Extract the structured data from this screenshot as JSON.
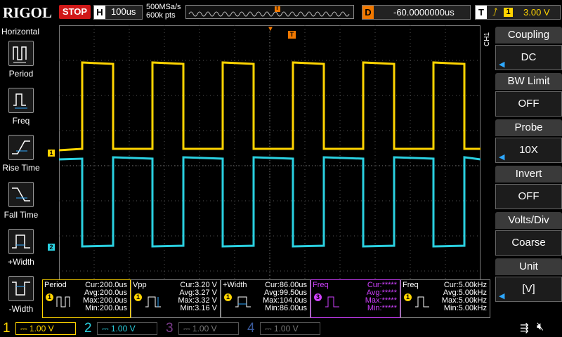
{
  "app": {
    "brand": "RIGOL",
    "run_state": "STOP"
  },
  "timebase": {
    "label": "H",
    "scale": "100us",
    "sample_rate": "500MSa/s",
    "memory_depth": "600k pts"
  },
  "delay": {
    "label": "D",
    "value": "-60.0000000us"
  },
  "trigger": {
    "label": "T",
    "edge_icon": "rising-edge-icon",
    "source": "1",
    "level": "3.00 V"
  },
  "left_menu": {
    "title": "Horizontal",
    "items": [
      {
        "label": "Period",
        "icon": "period-icon"
      },
      {
        "label": "Freq",
        "icon": "freq-icon"
      },
      {
        "label": "Rise Time",
        "icon": "rise-time-icon"
      },
      {
        "label": "Fall Time",
        "icon": "fall-time-icon"
      },
      {
        "label": "+Width",
        "icon": "pos-width-icon"
      },
      {
        "label": "-Width",
        "icon": "neg-width-icon"
      }
    ]
  },
  "right_menu": {
    "channel_tag": "CH1",
    "items": [
      {
        "label": "Coupling",
        "value": "DC",
        "has_arrow": true
      },
      {
        "label": "BW Limit",
        "value": "OFF",
        "has_arrow": false
      },
      {
        "label": "Probe",
        "value": "10X",
        "has_arrow": true
      },
      {
        "label": "Invert",
        "value": "OFF",
        "has_arrow": false
      },
      {
        "label": "Volts/Div",
        "value": "Coarse",
        "has_arrow": false
      },
      {
        "label": "Unit",
        "value": "[V]",
        "has_arrow": true
      }
    ]
  },
  "channel_markers": {
    "ch1": "1",
    "ch2": "2",
    "trigger_pos": "T"
  },
  "measurements": [
    {
      "name": "Period",
      "source": "1",
      "color": "#ffd400",
      "cur": "Cur:200.0us",
      "avg": "Avg:200.0us",
      "max": "Max:200.0us",
      "min": "Min:200.0us"
    },
    {
      "name": "Vpp",
      "source": "1",
      "color": "#ffd400",
      "cur": "Cur:3.20 V",
      "avg": "Avg:3.27 V",
      "max": "Max:3.32 V",
      "min": "Min:3.16 V"
    },
    {
      "name": "+Width",
      "source": "1",
      "color": "#ffd400",
      "cur": "Cur:86.00us",
      "avg": "Avg:99.50us",
      "max": "Max:104.0us",
      "min": "Min:86.00us"
    },
    {
      "name": "Freq",
      "source": "3",
      "color": "#d040ff",
      "cur": "Cur:*****",
      "avg": "Avg:*****",
      "max": "Max:*****",
      "min": "Min:*****"
    },
    {
      "name": "Freq",
      "source": "1",
      "color": "#ffd400",
      "cur": "Cur:5.00kHz",
      "avg": "Avg:5.00kHz",
      "max": "Max:5.00kHz",
      "min": "Min:5.00kHz"
    }
  ],
  "channels": [
    {
      "num": "1",
      "scale": "1.00 V",
      "color": "#ffd400",
      "active": true
    },
    {
      "num": "2",
      "scale": "1.00 V",
      "color": "#2ad0e0",
      "active": true
    },
    {
      "num": "3",
      "scale": "1.00 V",
      "color": "#a040c0",
      "active": false
    },
    {
      "num": "4",
      "scale": "1.00 V",
      "color": "#3060c0",
      "active": false
    }
  ],
  "colors": {
    "ch1": "#ffd400",
    "ch2": "#2ad0e0",
    "ch3": "#d040ff",
    "trigger": "#f07800",
    "stop": "#d01818"
  }
}
